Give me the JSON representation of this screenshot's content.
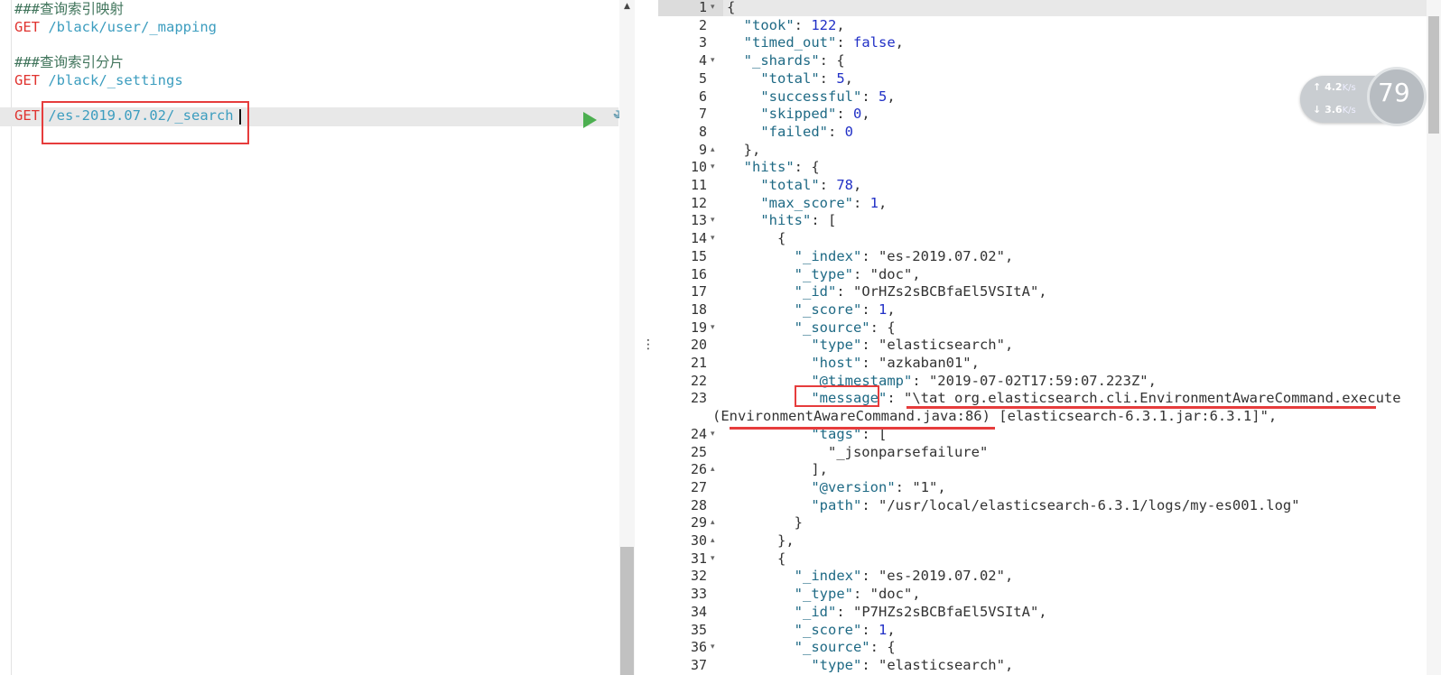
{
  "request": {
    "lines": [
      {
        "type": "comment",
        "text": "###查询索引映射"
      },
      {
        "type": "request",
        "method": "GET",
        "url": "/black/user/_mapping"
      },
      {
        "type": "blank",
        "text": ""
      },
      {
        "type": "comment",
        "text": "###查询索引分片"
      },
      {
        "type": "request",
        "method": "GET",
        "url": "/black/_settings"
      },
      {
        "type": "blank",
        "text": ""
      },
      {
        "type": "request",
        "method": "GET",
        "url": "/es-2019.07.02/_search"
      }
    ],
    "play_icon": "play-icon",
    "wrench_icon": "wrench-icon"
  },
  "splitter": {
    "dots": "⋮"
  },
  "response": {
    "lines": [
      {
        "n": "1",
        "fold": "▾",
        "text": "{"
      },
      {
        "n": "2",
        "fold": "",
        "text": "  \"took\": 122,"
      },
      {
        "n": "3",
        "fold": "",
        "text": "  \"timed_out\": false,"
      },
      {
        "n": "4",
        "fold": "▾",
        "text": "  \"_shards\": {"
      },
      {
        "n": "5",
        "fold": "",
        "text": "    \"total\": 5,"
      },
      {
        "n": "6",
        "fold": "",
        "text": "    \"successful\": 5,"
      },
      {
        "n": "7",
        "fold": "",
        "text": "    \"skipped\": 0,"
      },
      {
        "n": "8",
        "fold": "",
        "text": "    \"failed\": 0"
      },
      {
        "n": "9",
        "fold": "▴",
        "text": "  },"
      },
      {
        "n": "10",
        "fold": "▾",
        "text": "  \"hits\": {"
      },
      {
        "n": "11",
        "fold": "",
        "text": "    \"total\": 78,"
      },
      {
        "n": "12",
        "fold": "",
        "text": "    \"max_score\": 1,"
      },
      {
        "n": "13",
        "fold": "▾",
        "text": "    \"hits\": ["
      },
      {
        "n": "14",
        "fold": "▾",
        "text": "      {"
      },
      {
        "n": "15",
        "fold": "",
        "text": "        \"_index\": \"es-2019.07.02\","
      },
      {
        "n": "16",
        "fold": "",
        "text": "        \"_type\": \"doc\","
      },
      {
        "n": "17",
        "fold": "",
        "text": "        \"_id\": \"OrHZs2sBCBfaEl5VSItA\","
      },
      {
        "n": "18",
        "fold": "",
        "text": "        \"_score\": 1,"
      },
      {
        "n": "19",
        "fold": "▾",
        "text": "        \"_source\": {"
      },
      {
        "n": "20",
        "fold": "",
        "text": "          \"type\": \"elasticsearch\","
      },
      {
        "n": "21",
        "fold": "",
        "text": "          \"host\": \"azkaban01\","
      },
      {
        "n": "22",
        "fold": "",
        "text": "          \"@timestamp\": \"2019-07-02T17:59:07.223Z\","
      },
      {
        "n": "23",
        "fold": "",
        "text": "          \"message\": \"\\tat org.elasticsearch.cli.EnvironmentAwareCommand.execute"
      },
      {
        "n": "",
        "fold": "",
        "text": "(EnvironmentAwareCommand.java:86) [elasticsearch-6.3.1.jar:6.3.1]\","
      },
      {
        "n": "24",
        "fold": "▾",
        "text": "          \"tags\": ["
      },
      {
        "n": "25",
        "fold": "",
        "text": "            \"_jsonparsefailure\""
      },
      {
        "n": "26",
        "fold": "▴",
        "text": "          ],"
      },
      {
        "n": "27",
        "fold": "",
        "text": "          \"@version\": \"1\","
      },
      {
        "n": "28",
        "fold": "",
        "text": "          \"path\": \"/usr/local/elasticsearch-6.3.1/logs/my-es001.log\""
      },
      {
        "n": "29",
        "fold": "▴",
        "text": "        }"
      },
      {
        "n": "30",
        "fold": "▴",
        "text": "      },"
      },
      {
        "n": "31",
        "fold": "▾",
        "text": "      {"
      },
      {
        "n": "32",
        "fold": "",
        "text": "        \"_index\": \"es-2019.07.02\","
      },
      {
        "n": "33",
        "fold": "",
        "text": "        \"_type\": \"doc\","
      },
      {
        "n": "34",
        "fold": "",
        "text": "        \"_id\": \"P7HZs2sBCBfaEl5VSItA\","
      },
      {
        "n": "35",
        "fold": "",
        "text": "        \"_score\": 1,"
      },
      {
        "n": "36",
        "fold": "▾",
        "text": "        \"_source\": {"
      },
      {
        "n": "37",
        "fold": "",
        "text": "          \"type\": \"elasticsearch\","
      }
    ]
  },
  "network_widget": {
    "up_speed": "4.2",
    "down_speed": "3.6",
    "unit": "K/s",
    "percent": "79",
    "up_arrow": "↑",
    "down_arrow": "↓"
  }
}
